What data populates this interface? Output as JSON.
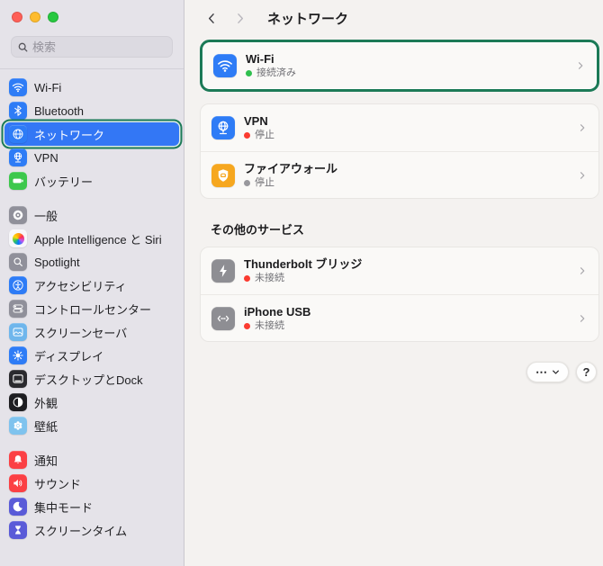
{
  "window": {
    "controls": [
      {
        "name": "close-button",
        "color": "#ff5f57"
      },
      {
        "name": "minimize-button",
        "color": "#febc2e"
      },
      {
        "name": "zoom-button",
        "color": "#28c840"
      }
    ]
  },
  "sidebar": {
    "search": {
      "placeholder": "検索",
      "icon": "search-icon"
    },
    "groups": [
      {
        "items": [
          {
            "id": "wifi",
            "label": "Wi-Fi",
            "icon": "wifi-icon",
            "color": "#2e7cf6"
          },
          {
            "id": "bluetooth",
            "label": "Bluetooth",
            "icon": "bluetooth-icon",
            "color": "#2e7cf6"
          },
          {
            "id": "network",
            "label": "ネットワーク",
            "icon": "globe-icon",
            "color": "#2e7cf6",
            "selected": true
          },
          {
            "id": "vpn",
            "label": "VPN",
            "icon": "vpn-globe-icon",
            "color": "#2e7cf6"
          },
          {
            "id": "battery",
            "label": "バッテリー",
            "icon": "battery-icon",
            "color": "#3dc84c"
          }
        ]
      },
      {
        "items": [
          {
            "id": "general",
            "label": "一般",
            "icon": "gear-icon",
            "color": "#90909a"
          },
          {
            "id": "apple-intelligence",
            "label": "Apple Intelligence と Siri",
            "icon": "apple-intelligence-icon",
            "color": "#f7f7fa"
          },
          {
            "id": "spotlight",
            "label": "Spotlight",
            "icon": "spotlight-icon",
            "color": "#90909a"
          },
          {
            "id": "accessibility",
            "label": "アクセシビリティ",
            "icon": "accessibility-icon",
            "color": "#2e7cf6"
          },
          {
            "id": "control-center",
            "label": "コントロールセンター",
            "icon": "control-center-icon",
            "color": "#90909a"
          },
          {
            "id": "screen-saver",
            "label": "スクリーンセーバ",
            "icon": "screensaver-icon",
            "color": "#6fb6ec"
          },
          {
            "id": "display",
            "label": "ディスプレイ",
            "icon": "sun-icon",
            "color": "#2e7cf6"
          },
          {
            "id": "desktop-dock",
            "label": "デスクトップとDock",
            "icon": "desktop-dock-icon",
            "color": "#2a2a2e"
          },
          {
            "id": "appearance",
            "label": "外観",
            "icon": "appearance-icon",
            "color": "#1d1d21"
          },
          {
            "id": "wallpaper",
            "label": "壁紙",
            "icon": "flower-icon",
            "color": "#7fc3ee"
          }
        ]
      },
      {
        "items": [
          {
            "id": "notifications",
            "label": "通知",
            "icon": "bell-icon",
            "color": "#fb4044"
          },
          {
            "id": "sound",
            "label": "サウンド",
            "icon": "speaker-icon",
            "color": "#fb4044"
          },
          {
            "id": "focus",
            "label": "集中モード",
            "icon": "moon-icon",
            "color": "#5a5bd8"
          },
          {
            "id": "screen-time",
            "label": "スクリーンタイム",
            "icon": "hourglass-icon",
            "color": "#5a5bd8"
          }
        ]
      }
    ]
  },
  "content": {
    "nav": {
      "title": "ネットワーク",
      "back_icon": "chevron-left-icon",
      "forward_icon": "chevron-right-icon"
    },
    "sections": [
      {
        "title": "",
        "cards": [
          {
            "highlighted": true,
            "rows": [
              {
                "id": "wifi",
                "label": "Wi-Fi",
                "icon": "wifi-icon",
                "color": "#2e7cf6",
                "status": "接続済み",
                "status_color": "#2fbf4e"
              }
            ]
          },
          {
            "highlighted": false,
            "rows": [
              {
                "id": "vpn",
                "label": "VPN",
                "icon": "vpn-globe-icon",
                "color": "#2e7cf6",
                "status": "停止",
                "status_color": "#fb3b30"
              },
              {
                "id": "firewall",
                "label": "ファイアウォール",
                "icon": "firewall-icon",
                "color": "#f6a71f",
                "status": "停止",
                "status_color": "#98989d"
              }
            ]
          }
        ]
      },
      {
        "title": "その他のサービス",
        "cards": [
          {
            "highlighted": false,
            "rows": [
              {
                "id": "thunderbolt-bridge",
                "label": "Thunderbolt ブリッジ",
                "icon": "thunderbolt-icon",
                "color": "#8e8e93",
                "status": "未接続",
                "status_color": "#fb3b30"
              },
              {
                "id": "iphone-usb",
                "label": "iPhone USB",
                "icon": "iphone-usb-icon",
                "color": "#8e8e93",
                "status": "未接続",
                "status_color": "#fb3b30"
              }
            ]
          }
        ]
      }
    ],
    "footer": {
      "more_label": "⋯",
      "help_label": "?"
    }
  },
  "colors": {
    "highlight_border": "#1c7a57",
    "selection_blue": "#3377f5"
  }
}
